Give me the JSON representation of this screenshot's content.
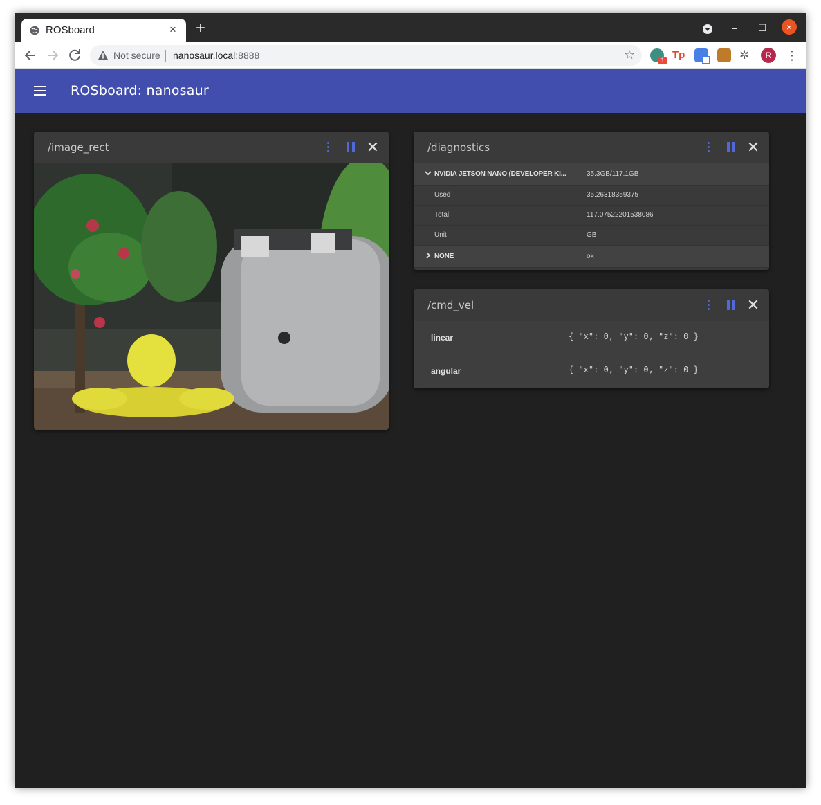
{
  "browser": {
    "tab_title": "ROSboard",
    "tab_close": "×",
    "new_tab": "+",
    "security_label": "Not secure",
    "url_host": "nanosaur.local",
    "url_port": ":8888",
    "extension_badge": "1",
    "ext_tp_label": "Tp",
    "avatar_letter": "R",
    "window_controls": {
      "minimize": "–",
      "maximize": "☐",
      "close": "×"
    }
  },
  "app": {
    "title": "ROSboard: nanosaur",
    "accent_color": "#414eae",
    "control_color": "#5068d8"
  },
  "cards": {
    "image": {
      "topic": "/image_rect",
      "close": "✕"
    },
    "diagnostics": {
      "topic": "/diagnostics",
      "close": "✕",
      "rows": [
        {
          "key": "NVIDIA JETSON NANO (DEVELOPER KI...",
          "value": "35.3GB/117.1GB"
        },
        {
          "key": "Used",
          "value": "35.26318359375"
        },
        {
          "key": "Total",
          "value": "117.07522201538086"
        },
        {
          "key": "Unit",
          "value": "GB"
        },
        {
          "key": "NONE",
          "value": "ok"
        }
      ]
    },
    "cmd_vel": {
      "topic": "/cmd_vel",
      "close": "✕",
      "rows": [
        {
          "key": "linear",
          "value": "{ \"x\": 0, \"y\": 0, \"z\": 0 }"
        },
        {
          "key": "angular",
          "value": "{ \"x\": 0, \"y\": 0, \"z\": 0 }"
        }
      ]
    }
  }
}
